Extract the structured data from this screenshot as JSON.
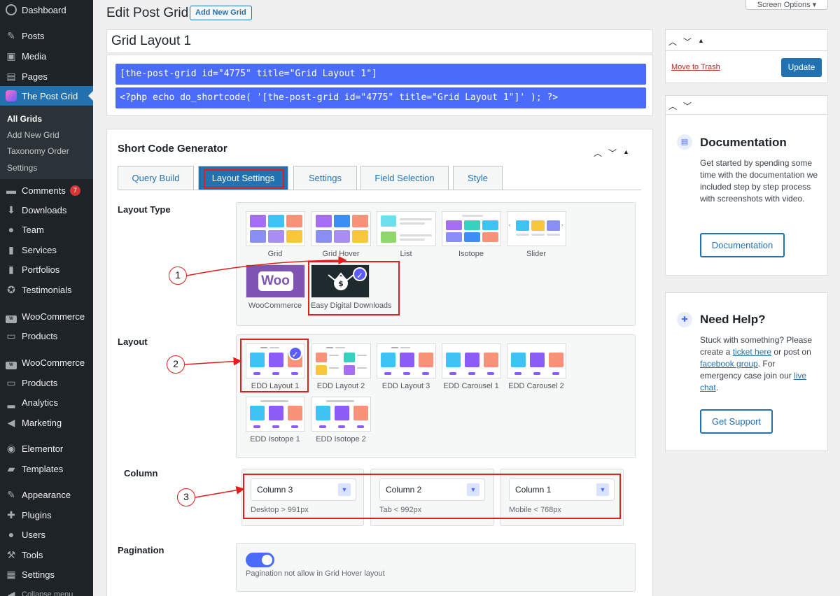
{
  "sidebar": {
    "items": [
      {
        "label": "Dashboard",
        "icon": "dashboard-icon"
      },
      {
        "label": "Posts",
        "icon": "pin-icon"
      },
      {
        "label": "Media",
        "icon": "media-icon"
      },
      {
        "label": "Pages",
        "icon": "pages-icon"
      },
      {
        "label": "The Post Grid",
        "icon": "post-grid-icon"
      },
      {
        "label": "Comments",
        "icon": "comment-icon",
        "badge": "7"
      },
      {
        "label": "Downloads",
        "icon": "download-icon"
      },
      {
        "label": "Team",
        "icon": "team-icon"
      },
      {
        "label": "Services",
        "icon": "services-icon"
      },
      {
        "label": "Portfolios",
        "icon": "portfolio-icon"
      },
      {
        "label": "Testimonials",
        "icon": "testimonial-icon"
      },
      {
        "label": "WooCommerce",
        "icon": "woo-icon"
      },
      {
        "label": "Products",
        "icon": "products-icon"
      },
      {
        "label": "WooCommerce",
        "icon": "woo-icon"
      },
      {
        "label": "Products",
        "icon": "products-icon"
      },
      {
        "label": "Analytics",
        "icon": "analytics-icon"
      },
      {
        "label": "Marketing",
        "icon": "marketing-icon"
      },
      {
        "label": "Elementor",
        "icon": "elementor-icon"
      },
      {
        "label": "Templates",
        "icon": "templates-icon"
      },
      {
        "label": "Appearance",
        "icon": "appearance-icon"
      },
      {
        "label": "Plugins",
        "icon": "plugins-icon"
      },
      {
        "label": "Users",
        "icon": "users-icon"
      },
      {
        "label": "Tools",
        "icon": "tools-icon"
      },
      {
        "label": "Settings",
        "icon": "settings-icon"
      },
      {
        "label": "Collapse menu",
        "icon": "collapse-icon"
      }
    ],
    "submenu": [
      "All Grids",
      "Add New Grid",
      "Taxonomy Order",
      "Settings"
    ]
  },
  "header": {
    "title": "Edit Post Grid",
    "add_new": "Add New Grid",
    "screen_options": "Screen Options ▾"
  },
  "post_title": "Grid Layout 1",
  "shortcodes": [
    "[the-post-grid id=\"4775\" title=\"Grid Layout 1\"]",
    "<?php echo do_shortcode( '[the-post-grid id=\"4775\" title=\"Grid Layout 1\"]' ); ?>"
  ],
  "generator": {
    "title": "Short Code Generator",
    "tabs": [
      "Query Build",
      "Layout Settings",
      "Settings",
      "Field Selection",
      "Style"
    ],
    "layout_type_label": "Layout Type",
    "layout_types": [
      "Grid",
      "Grid Hover",
      "List",
      "Isotope",
      "Slider",
      "WooCommerce",
      "Easy Digital Downloads"
    ],
    "woo_logo_text": "Woo",
    "layout_label": "Layout",
    "layouts": [
      "EDD Layout 1",
      "EDD Layout 2",
      "EDD Layout 3",
      "EDD Carousel 1",
      "EDD Carousel 2",
      "EDD Isotope 1",
      "EDD Isotope 2"
    ],
    "column_label": "Column",
    "columns": [
      {
        "value": "Column 3",
        "note": "Desktop > 991px"
      },
      {
        "value": "Column 2",
        "note": "Tab < 992px"
      },
      {
        "value": "Column 1",
        "note": "Mobile < 768px"
      }
    ],
    "pagination_label": "Pagination",
    "pagination_note": "Pagination not allow in Grid Hover layout",
    "annotations": [
      "1",
      "2",
      "3"
    ]
  },
  "publish": {
    "trash": "Move to Trash",
    "update": "Update"
  },
  "documentation": {
    "title": "Documentation",
    "text": "Get started by spending some time with the documentation we included step by step process with screenshots with video.",
    "button": "Documentation"
  },
  "help": {
    "title": "Need Help?",
    "text_1": "Stuck with something? Please create a ",
    "link_1": "ticket here",
    "text_2": " or post on ",
    "link_2": "facebook group",
    "text_3": ". For emergency case join our ",
    "link_3": "live chat",
    "text_4": ".",
    "button": "Get Support"
  },
  "colors": {
    "accent": "#2271b1",
    "shortcode_bg": "#4b6cfb",
    "annotation": "#e11d1d",
    "sidebar_bg": "#1d2327"
  }
}
